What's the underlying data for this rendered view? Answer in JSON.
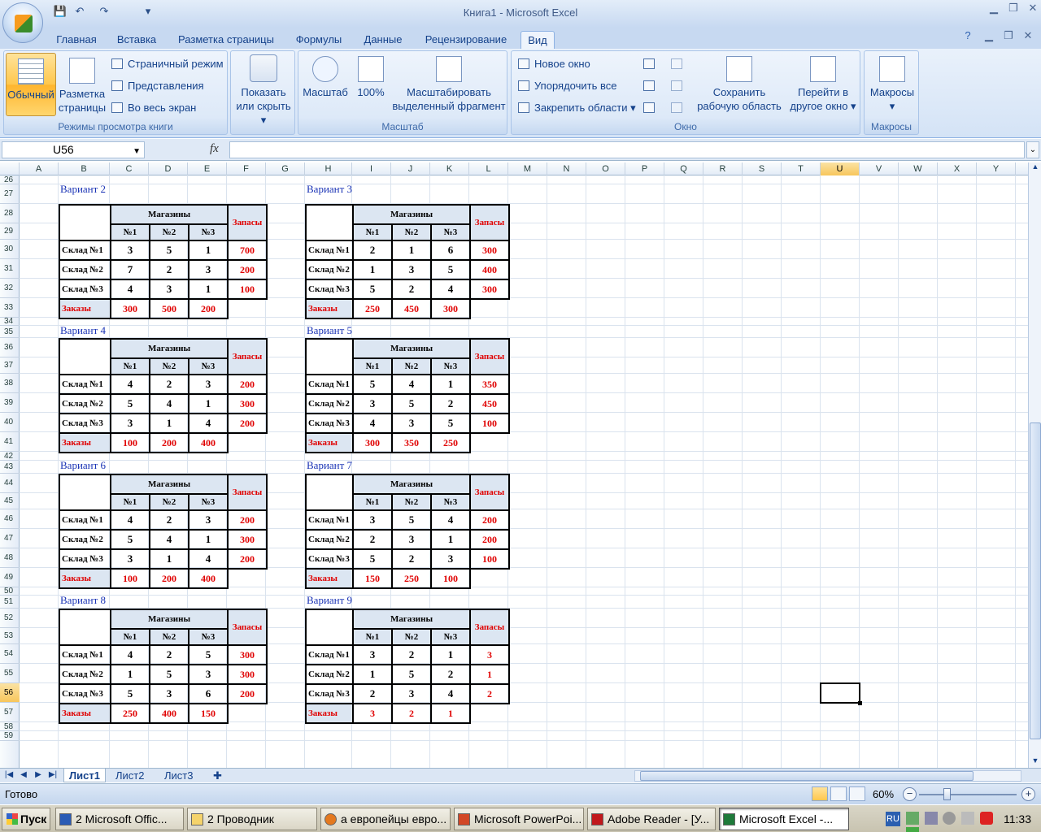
{
  "window": {
    "title": "Книга1 - Microsoft Excel"
  },
  "tabs": [
    "Главная",
    "Вставка",
    "Разметка страницы",
    "Формулы",
    "Данные",
    "Рецензирование",
    "Вид"
  ],
  "ribbon": {
    "views": {
      "normal": "Обычный",
      "page_layout_1": "Разметка",
      "page_layout_2": "страницы",
      "page_mode": "Страничный режим",
      "custom": "Представления",
      "fullscreen": "Во весь экран",
      "label": "Режимы просмотра книги"
    },
    "show": {
      "line1": "Показать",
      "line2": "или скрыть"
    },
    "zoom": {
      "zoom": "Масштаб",
      "p100": "100%",
      "fit1": "Масштабировать",
      "fit2": "выделенный фрагмент",
      "label": "Масштаб"
    },
    "window": {
      "new": "Новое окно",
      "arrange": "Упорядочить все",
      "freeze": "Закрепить области",
      "save1": "Сохранить",
      "save2": "рабочую область",
      "switch1": "Перейти в",
      "switch2": "другое окно",
      "label": "Окно"
    },
    "macros": {
      "btn": "Макросы",
      "label": "Макросы"
    }
  },
  "formula": {
    "namebox": "U56",
    "fx": "fx",
    "value": ""
  },
  "columns": [
    "A",
    "B",
    "C",
    "D",
    "E",
    "F",
    "G",
    "H",
    "I",
    "J",
    "K",
    "L",
    "M",
    "N",
    "O",
    "P",
    "Q",
    "R",
    "S",
    "T",
    "U",
    "V",
    "W",
    "X",
    "Y"
  ],
  "rows": [
    "26",
    "27",
    "28",
    "29",
    "30",
    "31",
    "32",
    "33",
    "34",
    "35",
    "36",
    "37",
    "38",
    "39",
    "40",
    "41",
    "42",
    "43",
    "44",
    "45",
    "46",
    "47",
    "48",
    "49",
    "50",
    "51",
    "52",
    "53",
    "54",
    "55",
    "56",
    "57",
    "58",
    "59"
  ],
  "table_labels": {
    "shops": "Магазины",
    "stock": "Запасы",
    "orders": "Заказы",
    "s1": "№1",
    "s2": "№2",
    "s3": "№3",
    "w1": "Склад №1",
    "w2": "Склад №2",
    "w3": "Склад №3"
  },
  "variants": [
    {
      "title": "Вариант 2",
      "costs": [
        [
          "3",
          "5",
          "1"
        ],
        [
          "7",
          "2",
          "3"
        ],
        [
          "4",
          "3",
          "1"
        ]
      ],
      "stock": [
        "700",
        "200",
        "100"
      ],
      "orders": [
        "300",
        "500",
        "200"
      ]
    },
    {
      "title": "Вариант 3",
      "costs": [
        [
          "2",
          "1",
          "6"
        ],
        [
          "1",
          "3",
          "5"
        ],
        [
          "5",
          "2",
          "4"
        ]
      ],
      "stock": [
        "300",
        "400",
        "300"
      ],
      "orders": [
        "250",
        "450",
        "300"
      ]
    },
    {
      "title": "Вариант 4",
      "costs": [
        [
          "4",
          "2",
          "3"
        ],
        [
          "5",
          "4",
          "1"
        ],
        [
          "3",
          "1",
          "4"
        ]
      ],
      "stock": [
        "200",
        "300",
        "200"
      ],
      "orders": [
        "100",
        "200",
        "400"
      ]
    },
    {
      "title": "Вариант 5",
      "costs": [
        [
          "5",
          "4",
          "1"
        ],
        [
          "3",
          "5",
          "2"
        ],
        [
          "4",
          "3",
          "5"
        ]
      ],
      "stock": [
        "350",
        "450",
        "100"
      ],
      "orders": [
        "300",
        "350",
        "250"
      ]
    },
    {
      "title": "Вариант 6",
      "costs": [
        [
          "4",
          "2",
          "3"
        ],
        [
          "5",
          "4",
          "1"
        ],
        [
          "3",
          "1",
          "4"
        ]
      ],
      "stock": [
        "200",
        "300",
        "200"
      ],
      "orders": [
        "100",
        "200",
        "400"
      ]
    },
    {
      "title": "Вариант 7",
      "costs": [
        [
          "3",
          "5",
          "4"
        ],
        [
          "2",
          "3",
          "1"
        ],
        [
          "5",
          "2",
          "3"
        ]
      ],
      "stock": [
        "200",
        "200",
        "100"
      ],
      "orders": [
        "150",
        "250",
        "100"
      ]
    },
    {
      "title": "Вариант 8",
      "costs": [
        [
          "4",
          "2",
          "5"
        ],
        [
          "1",
          "5",
          "3"
        ],
        [
          "5",
          "3",
          "6"
        ]
      ],
      "stock": [
        "300",
        "300",
        "200"
      ],
      "orders": [
        "250",
        "400",
        "150"
      ]
    },
    {
      "title": "Вариант 9",
      "costs": [
        [
          "3",
          "2",
          "1"
        ],
        [
          "1",
          "5",
          "2"
        ],
        [
          "2",
          "3",
          "4"
        ]
      ],
      "stock": [
        "3",
        "1",
        "2"
      ],
      "orders": [
        "3",
        "2",
        "1"
      ]
    }
  ],
  "sheet_tabs": [
    "Лист1",
    "Лист2",
    "Лист3"
  ],
  "status": {
    "ready": "Готово",
    "zoom": "60%"
  },
  "taskbar": {
    "start": "Пуск",
    "items": [
      "2 Microsoft Offic...",
      "2 Проводник",
      "а европейцы евро...",
      "Microsoft PowerPoi...",
      "Adobe Reader - [У...",
      "Microsoft Excel -..."
    ],
    "lang": "RU",
    "clock": "11:33"
  }
}
